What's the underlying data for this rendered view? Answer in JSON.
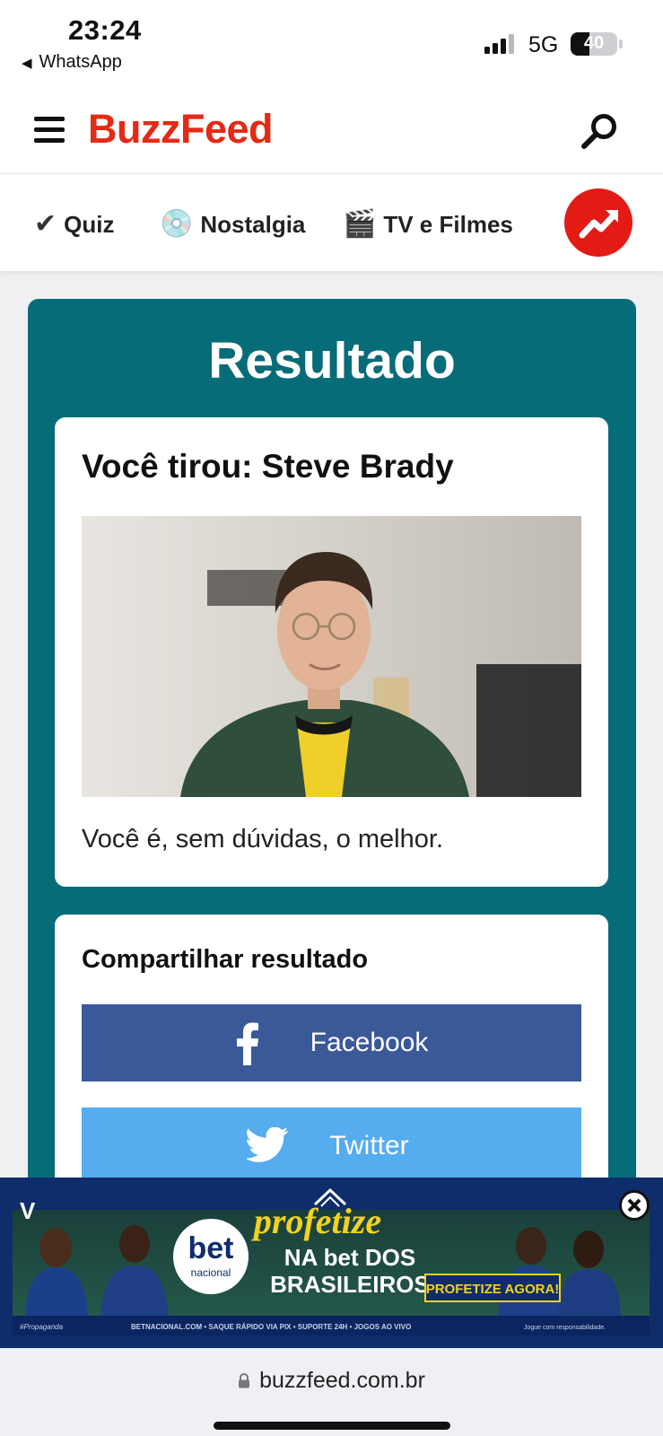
{
  "status_bar": {
    "time": "23:24",
    "back_app": "WhatsApp",
    "network": "5G",
    "battery": "40",
    "battery_level": 0.4
  },
  "header": {
    "logo": "BuzzFeed",
    "menu_icon": "hamburger-menu-icon",
    "search_icon": "search-icon"
  },
  "categories": [
    {
      "emoji": "✔",
      "label": "Quiz"
    },
    {
      "emoji": "💿",
      "label": "Nostalgia"
    },
    {
      "emoji": "🎬",
      "label": "TV e Filmes"
    }
  ],
  "trending_icon": "trending-arrow-icon",
  "result": {
    "title": "Resultado",
    "heading": "Você tirou: Steve Brady",
    "description": "Você é, sem dúvidas, o melhor."
  },
  "share": {
    "title": "Compartilhar resultado",
    "facebook_label": "Facebook",
    "twitter_label": "Twitter"
  },
  "ad": {
    "brand": "bet",
    "brand_sub": "nacional",
    "headline_1": "profetize",
    "headline_2": "NA bet DOS",
    "headline_3": "BRASILEIROS",
    "cta": "PROFETIZE AGORA!",
    "footer": "BETNACIONAL.COM • SAQUE RÁPIDO VIA PIX • SUPORTE 24H • JOGOS AO VIVO",
    "disclaimer": "Jogue com responsabilidade.",
    "tag": "#Propaganda",
    "close_icon": "close-icon",
    "expand_icon": "chevron-up-icon"
  },
  "browser": {
    "url": "buzzfeed.com.br"
  },
  "colors": {
    "brand_red": "#e32a15",
    "panel_teal": "#066c78",
    "facebook_blue": "#3b5998",
    "twitter_blue": "#55acee",
    "ad_navy": "#0f2d6b",
    "ad_yellow": "#f2d21f"
  }
}
